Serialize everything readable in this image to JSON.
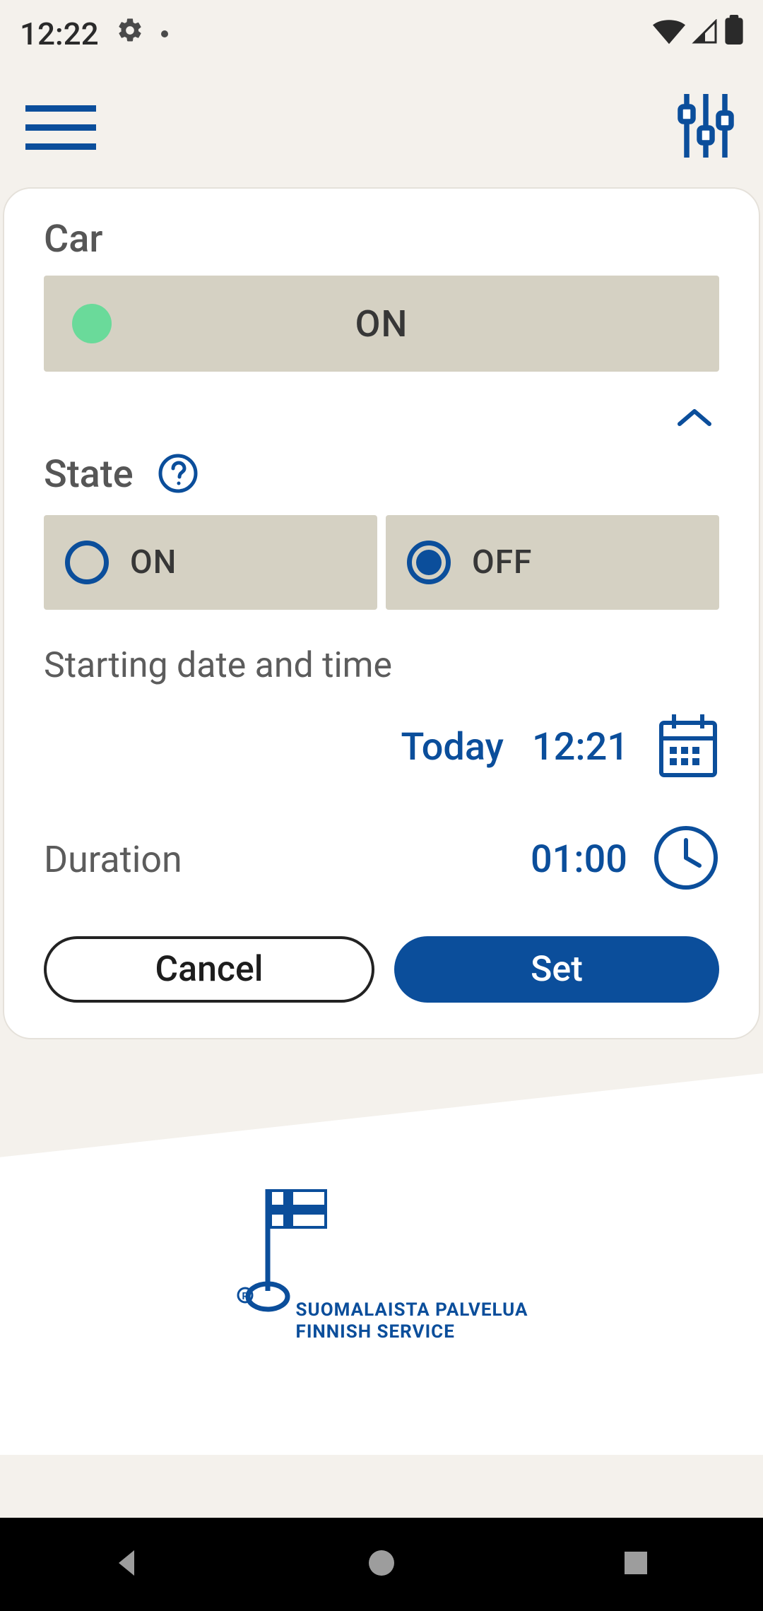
{
  "status_bar": {
    "time": "12:22"
  },
  "card": {
    "title": "Car",
    "main_state_label": "ON",
    "state_section_label": "State",
    "radio_on_label": "ON",
    "radio_off_label": "OFF",
    "radio_selected": "OFF",
    "start_label": "Starting date and time",
    "start_date": "Today",
    "start_time": "12:21",
    "duration_label": "Duration",
    "duration_value": "01:00",
    "cancel_label": "Cancel",
    "set_label": "Set"
  },
  "footer": {
    "line1": "SUOMALAISTA PALVELUA",
    "line2": "FINNISH SERVICE"
  },
  "colors": {
    "accent": "#0b4e9b",
    "pill_bg": "#d5d1c3",
    "green_dot": "#6ada9a",
    "page_bg": "#f4f1ec"
  }
}
